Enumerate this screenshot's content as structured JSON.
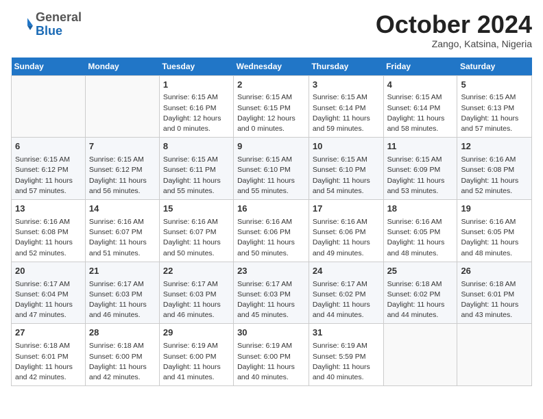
{
  "header": {
    "logo_general": "General",
    "logo_blue": "Blue",
    "month": "October 2024",
    "location": "Zango, Katsina, Nigeria"
  },
  "days_of_week": [
    "Sunday",
    "Monday",
    "Tuesday",
    "Wednesday",
    "Thursday",
    "Friday",
    "Saturday"
  ],
  "weeks": [
    [
      {
        "day": "",
        "info": ""
      },
      {
        "day": "",
        "info": ""
      },
      {
        "day": "1",
        "info": "Sunrise: 6:15 AM\nSunset: 6:16 PM\nDaylight: 12 hours\nand 0 minutes."
      },
      {
        "day": "2",
        "info": "Sunrise: 6:15 AM\nSunset: 6:15 PM\nDaylight: 12 hours\nand 0 minutes."
      },
      {
        "day": "3",
        "info": "Sunrise: 6:15 AM\nSunset: 6:14 PM\nDaylight: 11 hours\nand 59 minutes."
      },
      {
        "day": "4",
        "info": "Sunrise: 6:15 AM\nSunset: 6:14 PM\nDaylight: 11 hours\nand 58 minutes."
      },
      {
        "day": "5",
        "info": "Sunrise: 6:15 AM\nSunset: 6:13 PM\nDaylight: 11 hours\nand 57 minutes."
      }
    ],
    [
      {
        "day": "6",
        "info": "Sunrise: 6:15 AM\nSunset: 6:12 PM\nDaylight: 11 hours\nand 57 minutes."
      },
      {
        "day": "7",
        "info": "Sunrise: 6:15 AM\nSunset: 6:12 PM\nDaylight: 11 hours\nand 56 minutes."
      },
      {
        "day": "8",
        "info": "Sunrise: 6:15 AM\nSunset: 6:11 PM\nDaylight: 11 hours\nand 55 minutes."
      },
      {
        "day": "9",
        "info": "Sunrise: 6:15 AM\nSunset: 6:10 PM\nDaylight: 11 hours\nand 55 minutes."
      },
      {
        "day": "10",
        "info": "Sunrise: 6:15 AM\nSunset: 6:10 PM\nDaylight: 11 hours\nand 54 minutes."
      },
      {
        "day": "11",
        "info": "Sunrise: 6:15 AM\nSunset: 6:09 PM\nDaylight: 11 hours\nand 53 minutes."
      },
      {
        "day": "12",
        "info": "Sunrise: 6:16 AM\nSunset: 6:08 PM\nDaylight: 11 hours\nand 52 minutes."
      }
    ],
    [
      {
        "day": "13",
        "info": "Sunrise: 6:16 AM\nSunset: 6:08 PM\nDaylight: 11 hours\nand 52 minutes."
      },
      {
        "day": "14",
        "info": "Sunrise: 6:16 AM\nSunset: 6:07 PM\nDaylight: 11 hours\nand 51 minutes."
      },
      {
        "day": "15",
        "info": "Sunrise: 6:16 AM\nSunset: 6:07 PM\nDaylight: 11 hours\nand 50 minutes."
      },
      {
        "day": "16",
        "info": "Sunrise: 6:16 AM\nSunset: 6:06 PM\nDaylight: 11 hours\nand 50 minutes."
      },
      {
        "day": "17",
        "info": "Sunrise: 6:16 AM\nSunset: 6:06 PM\nDaylight: 11 hours\nand 49 minutes."
      },
      {
        "day": "18",
        "info": "Sunrise: 6:16 AM\nSunset: 6:05 PM\nDaylight: 11 hours\nand 48 minutes."
      },
      {
        "day": "19",
        "info": "Sunrise: 6:16 AM\nSunset: 6:05 PM\nDaylight: 11 hours\nand 48 minutes."
      }
    ],
    [
      {
        "day": "20",
        "info": "Sunrise: 6:17 AM\nSunset: 6:04 PM\nDaylight: 11 hours\nand 47 minutes."
      },
      {
        "day": "21",
        "info": "Sunrise: 6:17 AM\nSunset: 6:03 PM\nDaylight: 11 hours\nand 46 minutes."
      },
      {
        "day": "22",
        "info": "Sunrise: 6:17 AM\nSunset: 6:03 PM\nDaylight: 11 hours\nand 46 minutes."
      },
      {
        "day": "23",
        "info": "Sunrise: 6:17 AM\nSunset: 6:03 PM\nDaylight: 11 hours\nand 45 minutes."
      },
      {
        "day": "24",
        "info": "Sunrise: 6:17 AM\nSunset: 6:02 PM\nDaylight: 11 hours\nand 44 minutes."
      },
      {
        "day": "25",
        "info": "Sunrise: 6:18 AM\nSunset: 6:02 PM\nDaylight: 11 hours\nand 44 minutes."
      },
      {
        "day": "26",
        "info": "Sunrise: 6:18 AM\nSunset: 6:01 PM\nDaylight: 11 hours\nand 43 minutes."
      }
    ],
    [
      {
        "day": "27",
        "info": "Sunrise: 6:18 AM\nSunset: 6:01 PM\nDaylight: 11 hours\nand 42 minutes."
      },
      {
        "day": "28",
        "info": "Sunrise: 6:18 AM\nSunset: 6:00 PM\nDaylight: 11 hours\nand 42 minutes."
      },
      {
        "day": "29",
        "info": "Sunrise: 6:19 AM\nSunset: 6:00 PM\nDaylight: 11 hours\nand 41 minutes."
      },
      {
        "day": "30",
        "info": "Sunrise: 6:19 AM\nSunset: 6:00 PM\nDaylight: 11 hours\nand 40 minutes."
      },
      {
        "day": "31",
        "info": "Sunrise: 6:19 AM\nSunset: 5:59 PM\nDaylight: 11 hours\nand 40 minutes."
      },
      {
        "day": "",
        "info": ""
      },
      {
        "day": "",
        "info": ""
      }
    ]
  ]
}
